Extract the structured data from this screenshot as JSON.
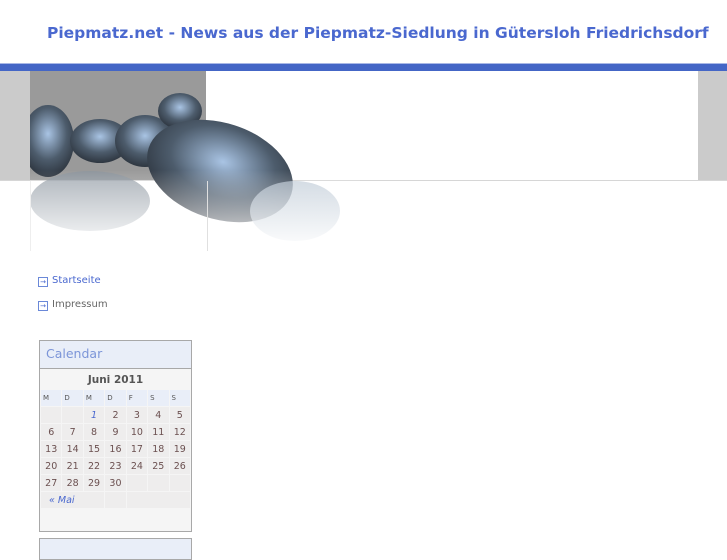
{
  "header": {
    "title": "Piepmatz.net - News aus der Piepmatz-Siedlung in Gütersloh Friedrichsdorf"
  },
  "nav": [
    {
      "label": "Startseite",
      "color": "#4a68cf"
    },
    {
      "label": "Impressum",
      "color": "#666666"
    }
  ],
  "calendar": {
    "title": "Calendar",
    "month": "Juni 2011",
    "weekdays": [
      "M",
      "D",
      "M",
      "D",
      "F",
      "S",
      "S"
    ],
    "weeks": [
      [
        "",
        "",
        "1",
        "2",
        "3",
        "4",
        "5"
      ],
      [
        "6",
        "7",
        "8",
        "9",
        "10",
        "11",
        "12"
      ],
      [
        "13",
        "14",
        "15",
        "16",
        "17",
        "18",
        "19"
      ],
      [
        "20",
        "21",
        "22",
        "23",
        "24",
        "25",
        "26"
      ],
      [
        "27",
        "28",
        "29",
        "30",
        "",
        "",
        ""
      ]
    ],
    "linked_day": "1",
    "prev": "« Mai"
  }
}
